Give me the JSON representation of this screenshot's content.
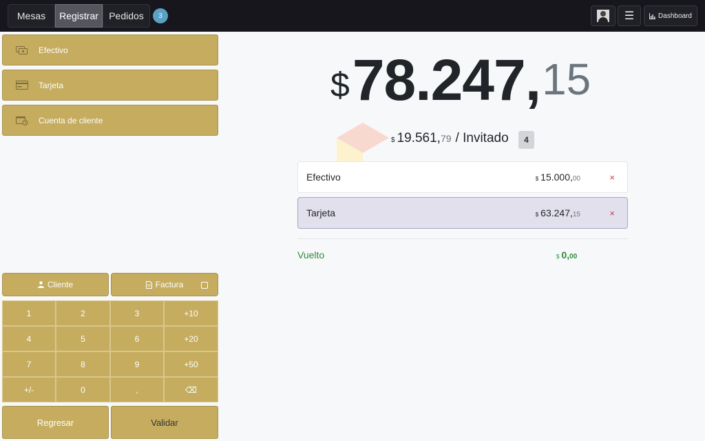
{
  "topbar": {
    "tabs": [
      {
        "label": "Mesas"
      },
      {
        "label": "Registrar"
      },
      {
        "label": "Pedidos"
      }
    ],
    "orders_badge": "3",
    "menu_icon": "hamburger-icon",
    "avatar_icon": "user-avatar",
    "dashboard_label": "Dashboard",
    "dashboard_icon": "bar-chart-icon"
  },
  "payment_methods": [
    {
      "label": "Efectivo",
      "icon": "cash-icon"
    },
    {
      "label": "Tarjeta",
      "icon": "card-icon"
    },
    {
      "label": "Cuenta de cliente",
      "icon": "wallet-clock-icon"
    }
  ],
  "actions": {
    "client_label": "Cliente",
    "invoice_label": "Factura",
    "back_label": "Regresar",
    "validate_label": "Validar"
  },
  "numpad": [
    "1",
    "2",
    "3",
    "+10",
    "4",
    "5",
    "6",
    "+20",
    "7",
    "8",
    "9",
    "+50",
    "+/-",
    "0",
    ",",
    "⌫"
  ],
  "summary": {
    "currency": "$",
    "total_int": "78.247,",
    "total_dec": "15",
    "per_guest_int": "19.561,",
    "per_guest_dec": "79",
    "per_guest_label": "/ Invitado",
    "guest_count": "4"
  },
  "payment_lines": [
    {
      "name": "Efectivo",
      "amount_int": "15.000,",
      "amount_dec": "00",
      "remove": "×"
    },
    {
      "name": "Tarjeta",
      "amount_int": "63.247,",
      "amount_dec": "15",
      "remove": "×"
    }
  ],
  "change": {
    "label": "Vuelto",
    "amount_int": "0,",
    "amount_dec": "00"
  },
  "colors": {
    "accent_gold": "#c5ac5f",
    "change_green": "#2e8b3a",
    "remove_red": "#dc3545",
    "selected_line": "#e1e0ec"
  }
}
